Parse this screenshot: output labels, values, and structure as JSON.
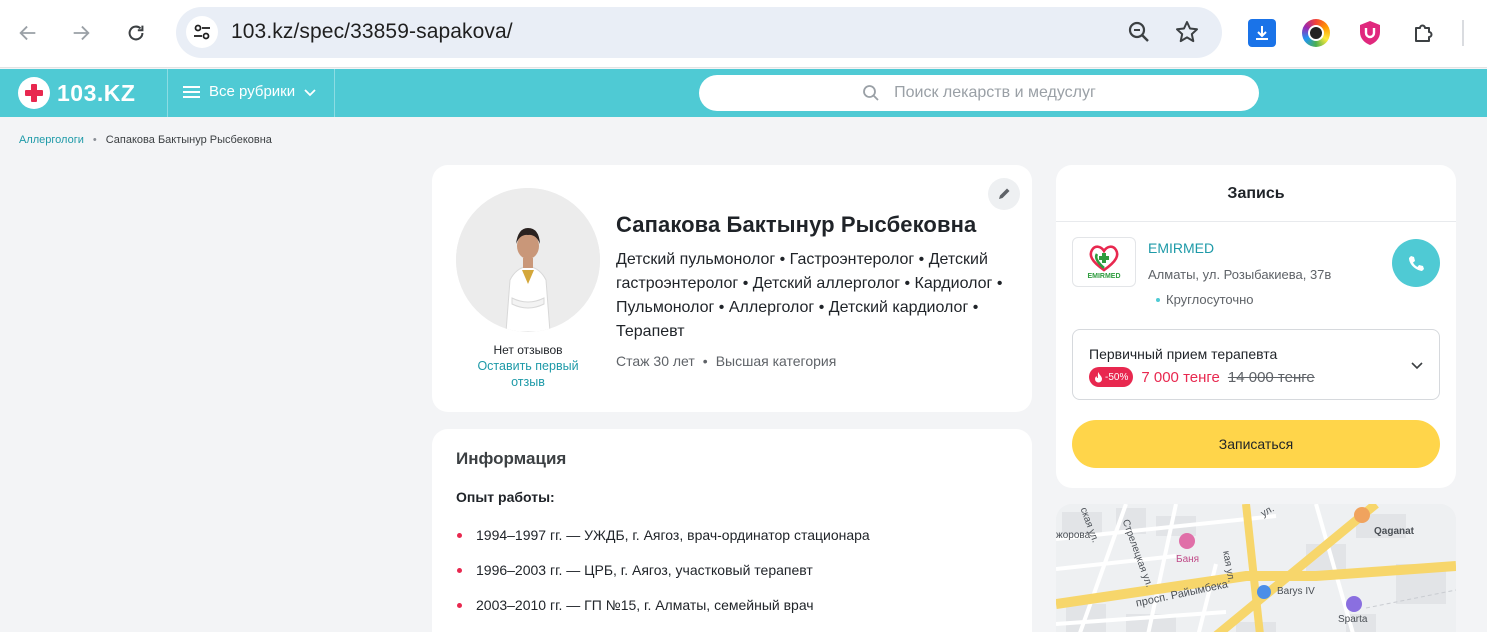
{
  "browser": {
    "url": "103.kz/spec/33859-sapakova/"
  },
  "site": {
    "logo_text": "103.KZ",
    "rubrics_label": "Все рубрики",
    "search_placeholder": "Поиск лекарств и медуслуг"
  },
  "breadcrumb": {
    "parent": "Аллергологи",
    "current": "Сапакова Бактынур Рысбековна"
  },
  "profile": {
    "name": "Сапакова Бактынур Рысбековна",
    "specialties": "Детский пульмонолог • Гастроэнтеролог • Детский гастроэнтеролог • Детский аллерголог • Кардиолог • Пульмонолог • Аллерголог • Детский кардиолог • Терапевт",
    "experience": "Стаж 30 лет",
    "separator": "•",
    "category": "Высшая категория",
    "no_reviews": "Нет отзывов",
    "leave_review": "Оставить первый отзыв"
  },
  "info": {
    "title": "Информация",
    "work_title": "Опыт работы:",
    "work": [
      "1994–1997 гг. — УЖДБ, г. Аягоз, врач-ординатор стационара",
      "1996–2003 гг. — ЦРБ, г. Аягоз, участковый терапевт",
      "2003–2010 гг. — ГП №15, г. Алматы, семейный врач"
    ]
  },
  "booking": {
    "title": "Запись",
    "clinic_logo_text": "EMIRMED",
    "clinic_name": "EMIRMED",
    "clinic_address": "Алматы, ул. Розыбакиева, 37в",
    "clinic_hours": "Круглосуточно",
    "service_name": "Первичный прием терапевта",
    "discount": "-50%",
    "price_new": "7 000 тенге",
    "price_old": "14 000 тенге",
    "button_label": "Записаться"
  },
  "map": {
    "labels": [
      "Qaganat",
      "Баня",
      "просп. Райымбека",
      "Barys IV",
      "Sparta",
      "жорова",
      "Стрелецкая ул.",
      "ская ул.",
      "ул.",
      "кая ул."
    ]
  },
  "colors": {
    "accent": "#4fcad4",
    "link": "#1e9aa8",
    "sale": "#e8284f",
    "button": "#ffd54a"
  }
}
